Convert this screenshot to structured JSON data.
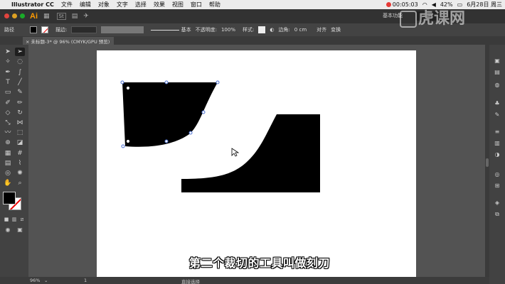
{
  "menubar": {
    "app_name": "Illustrator CC",
    "items": [
      "文件",
      "编辑",
      "对象",
      "文字",
      "选择",
      "效果",
      "视图",
      "窗口",
      "帮助"
    ],
    "record_time": "00:05:03",
    "battery": "42%",
    "date": "6月28日 周三"
  },
  "appbar": {
    "logo": "Ai",
    "st_label": "St",
    "workspace": "基本功能"
  },
  "controlbar": {
    "mode_label": "路径",
    "stroke_label": "描边:",
    "stroke_style": "基本",
    "opacity_label": "不透明度:",
    "opacity_value": "100%",
    "style_label": "样式:",
    "corner_label": "边角:",
    "corner_value": "0 cm",
    "align_label": "对齐",
    "transform_label": "变换"
  },
  "tab": {
    "title": "未标题-3* @ 96% (CMYK/GPU 预览)"
  },
  "canvas": {
    "subtitle": "第二个裁切的工具叫做刻刀"
  },
  "statusbar": {
    "zoom": "96%",
    "artboard_num": "1",
    "tool_name": "直接选择"
  },
  "watermark": {
    "text": "虎课网"
  },
  "colors": {
    "accent_ai": "#ff9a00",
    "canvas_bg": "#535353",
    "shape_fill": "#000000",
    "anchor": "#4a6fd0"
  }
}
